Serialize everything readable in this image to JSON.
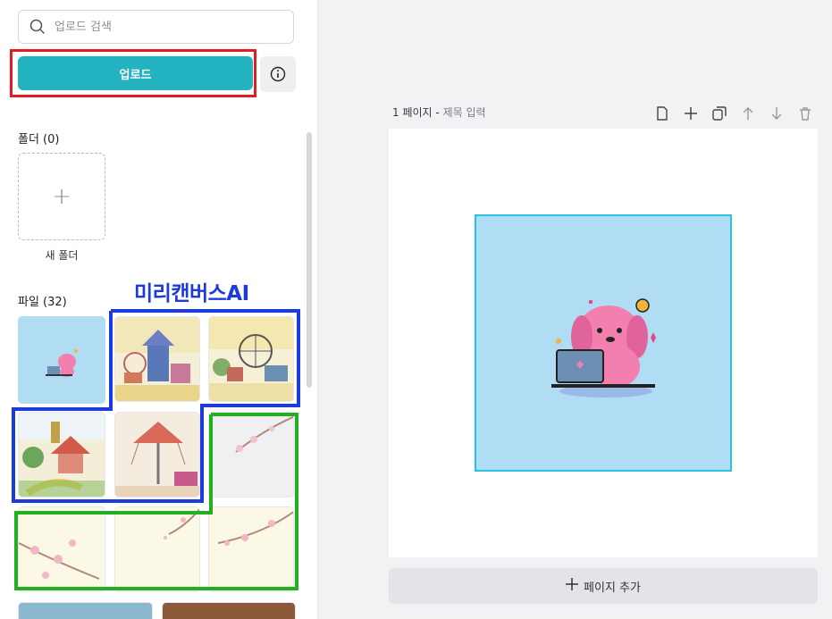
{
  "search": {
    "placeholder": "업로드 검색"
  },
  "upload": {
    "label": "업로드"
  },
  "folders": {
    "title": "폴더 (0)",
    "new_folder_label": "새 폴더"
  },
  "files": {
    "title": "파일 (32)",
    "annotation": "미리캔버스AI",
    "thumbnails": [
      {
        "name": "puppy-laptop"
      },
      {
        "name": "carousel-drawing"
      },
      {
        "name": "ferris-wheel-drawing"
      },
      {
        "name": "gazebo-drawing"
      },
      {
        "name": "swing-ride-drawing"
      },
      {
        "name": "cherry-blossom-1"
      },
      {
        "name": "cherry-blossom-2"
      },
      {
        "name": "cherry-blossom-3"
      },
      {
        "name": "cherry-blossom-4"
      },
      {
        "name": "sky-photo"
      },
      {
        "name": "wood-photo"
      }
    ]
  },
  "editor": {
    "page_number": "1 페이지",
    "title_placeholder": "제목 입력",
    "tools": [
      "page-icon",
      "plus-icon",
      "duplicate-icon",
      "arrow-up-icon",
      "arrow-down-icon",
      "trash-icon"
    ],
    "add_page_label": "페이지 추가"
  },
  "colors": {
    "accent": "#22b2c0",
    "annotation_red": "#e01e22",
    "annotation_blue": "#1b3bdc",
    "annotation_green": "#22b022",
    "art_bg": "#b0dcf4"
  }
}
